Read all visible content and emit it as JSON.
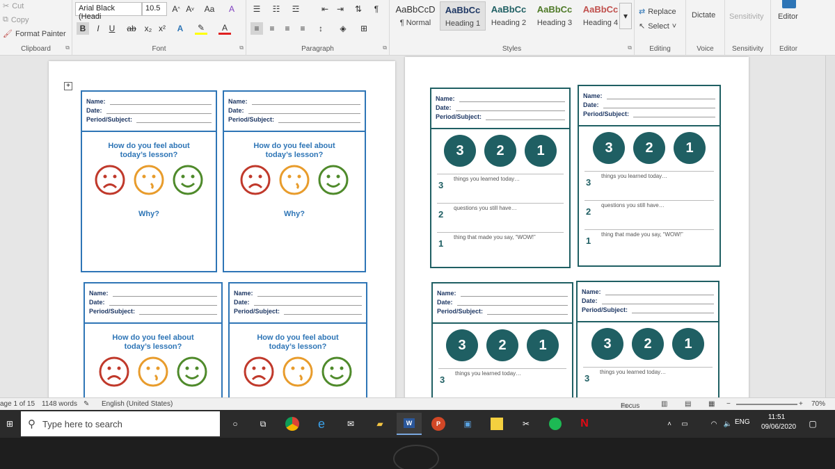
{
  "ribbon": {
    "clipboard": {
      "cut": "Cut",
      "copy": "Copy",
      "format_painter": "Format Painter",
      "label": "Clipboard"
    },
    "font": {
      "family": "Arial Black (Headi",
      "size": "10.5",
      "case": "Aa",
      "label": "Font"
    },
    "paragraph": {
      "label": "Paragraph"
    },
    "styles": {
      "label": "Styles",
      "items": [
        {
          "preview": "AaBbCcD",
          "name": "¶ Normal"
        },
        {
          "preview": "AaBbCc",
          "name": "Heading 1"
        },
        {
          "preview": "AaBbCc",
          "name": "Heading 2"
        },
        {
          "preview": "AaBbCc",
          "name": "Heading 3"
        },
        {
          "preview": "AaBbCc",
          "name": "Heading 4"
        }
      ]
    },
    "editing": {
      "replace": "Replace",
      "select": "Select",
      "label": "Editing"
    },
    "voice": {
      "dictate": "Dictate",
      "label": "Voice"
    },
    "sensitivity": {
      "button": "Sensitivity",
      "label": "Sensitivity"
    },
    "editor": {
      "button": "Editor",
      "label": "Editor"
    }
  },
  "card_fields": {
    "name": "Name:",
    "date": "Date:",
    "period": "Period/Subject:"
  },
  "feelings_card": {
    "question_line1": "How do you feel about",
    "question_line2": "today’s lesson?",
    "why": "Why?"
  },
  "card_321": {
    "circles": [
      "3",
      "2",
      "1"
    ],
    "rows": [
      {
        "num": "3",
        "text": "things you learned today…"
      },
      {
        "num": "2",
        "text": "questions you still have…"
      },
      {
        "num": "1",
        "text": "thing that made you say, “WOW!”"
      }
    ]
  },
  "status_bar": {
    "page": "age 1 of 15",
    "words": "1148 words",
    "language": "English (United States)",
    "focus": "Focus",
    "zoom": "70%"
  },
  "taskbar": {
    "search_placeholder": "Type here to search",
    "lang": "ENG",
    "time": "11:51",
    "date": "09/06/2020"
  }
}
